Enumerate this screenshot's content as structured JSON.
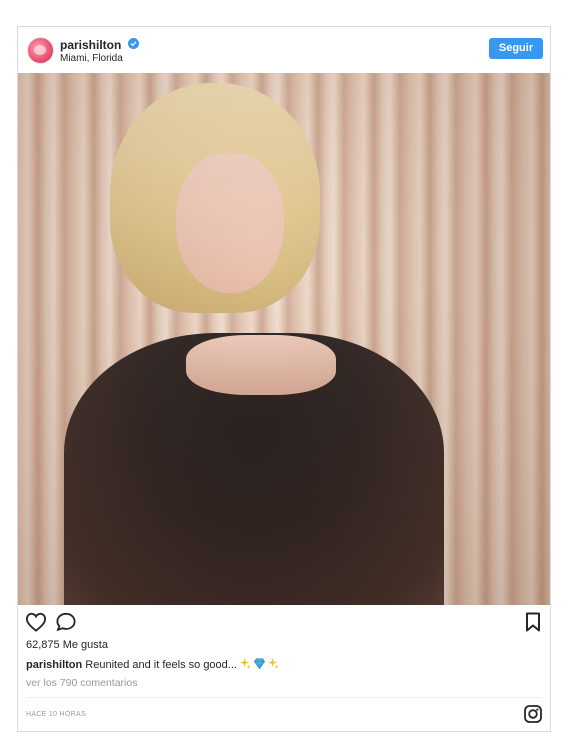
{
  "post": {
    "username": "parishilton",
    "location": "Miami, Florida",
    "follow_label": "Seguir",
    "likes_text": "62,875 Me gusta",
    "caption_user": "parishilton",
    "caption_text": "Reunited and it feels so good...",
    "caption_emojis": [
      "sparkles-icon",
      "gem-icon",
      "sparkles-icon"
    ],
    "view_comments": "ver los 790 comentarios",
    "timestamp": "HACE 10 HORAS"
  },
  "colors": {
    "accent": "#3897f0",
    "border": "#dbdbdb",
    "text": "#262626",
    "muted": "#999999"
  }
}
